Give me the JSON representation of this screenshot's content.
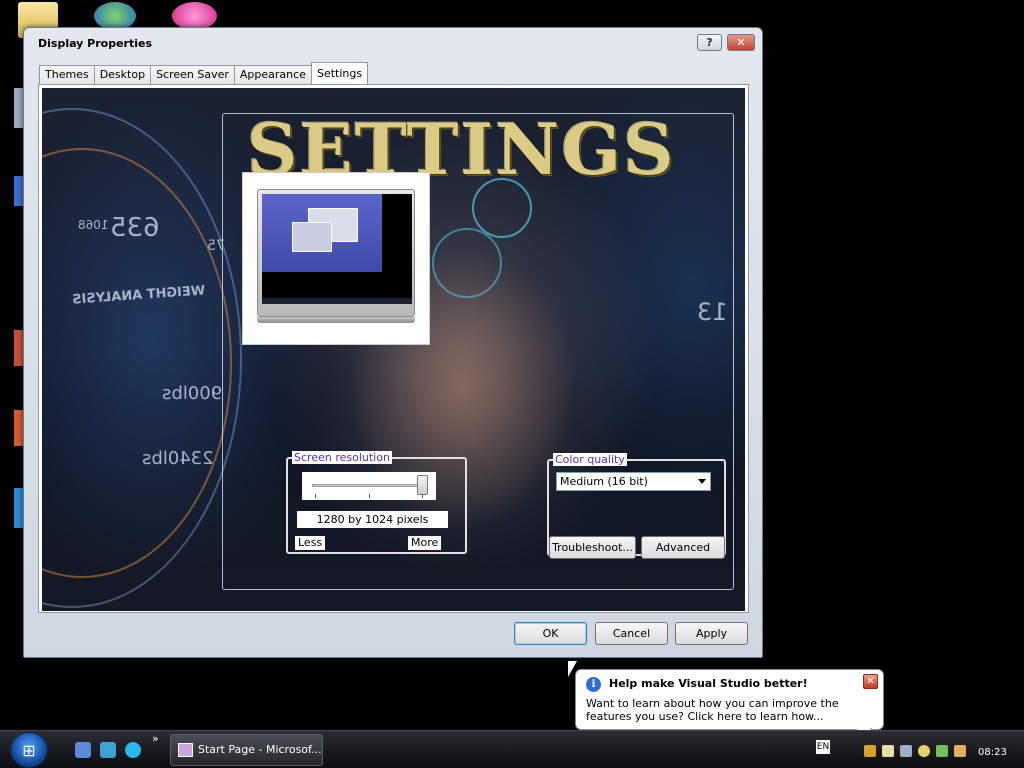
{
  "window": {
    "title": "Display Properties",
    "help_glyph": "?",
    "close_glyph": "✕"
  },
  "tabs": [
    {
      "label": "Themes"
    },
    {
      "label": "Desktop"
    },
    {
      "label": "Screen Saver"
    },
    {
      "label": "Appearance"
    },
    {
      "label": "Settings",
      "active": true
    }
  ],
  "background_text": {
    "big_word": "SETTINGS",
    "hud_1": "635",
    "hud_2": "1068",
    "hud_3": "75",
    "hud_4": "WEIGHT ANALYSIS",
    "hud_5": "900lbs",
    "hud_6": "2340lbs",
    "hud_7": "13"
  },
  "screen_resolution": {
    "legend": "Screen resolution",
    "value": "1280 by 1024 pixels",
    "less": "Less",
    "more": "More",
    "slider_position": 1.0
  },
  "color_quality": {
    "legend": "Color quality",
    "selected": "Medium (16 bit)",
    "troubleshoot": "Troubleshoot...",
    "advanced": "Advanced"
  },
  "buttons": {
    "ok": "OK",
    "cancel": "Cancel",
    "apply": "Apply"
  },
  "balloon": {
    "title": "Help make Visual Studio better!",
    "body": "Want to learn about how you can improve the features you use? Click here to learn how...",
    "icon": "i",
    "close": "✕"
  },
  "taskbar": {
    "start_glyph": "⊞",
    "chevron": "»",
    "task_label": "Start Page - Microsof...",
    "language": "EN",
    "clock": "08:23"
  },
  "colors": {
    "legend_text": "#5b2fb5",
    "title_gold": "#e6d58a",
    "close_red": "#c0432e"
  }
}
